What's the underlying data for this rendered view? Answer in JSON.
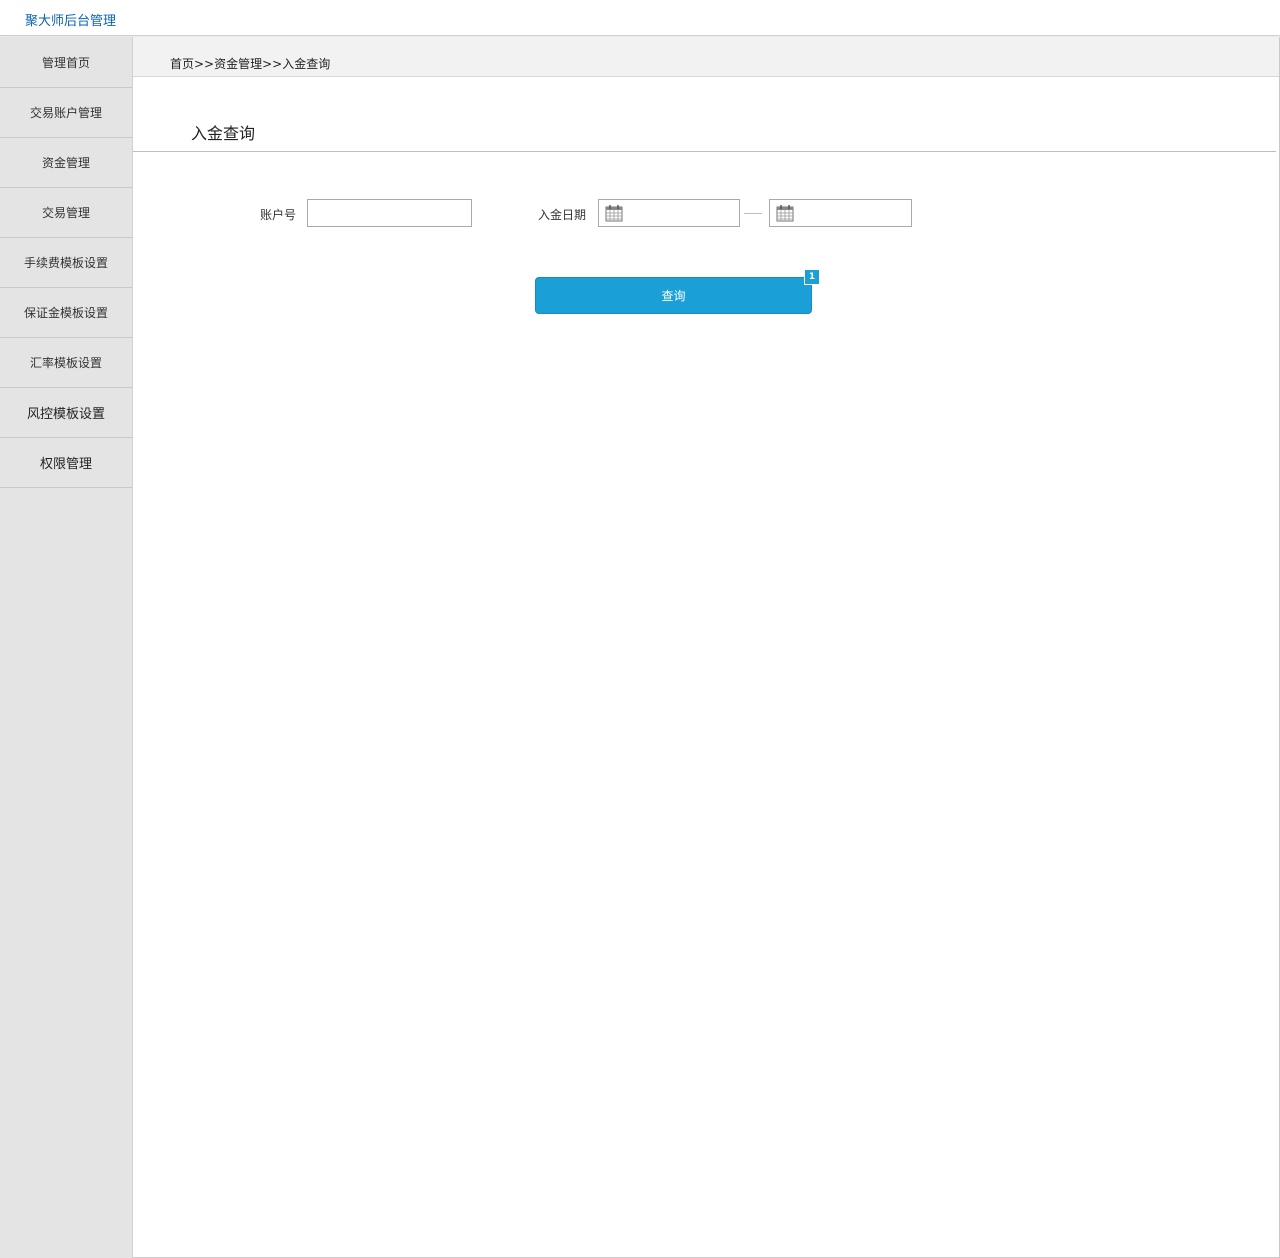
{
  "header": {
    "app_title": "聚大师后台管理"
  },
  "sidebar": {
    "items": [
      {
        "label": "管理首页"
      },
      {
        "label": "交易账户管理"
      },
      {
        "label": "资金管理"
      },
      {
        "label": "交易管理"
      },
      {
        "label": "手续费模板设置"
      },
      {
        "label": "保证金模板设置"
      },
      {
        "label": "汇率模板设置"
      },
      {
        "label": "风控模板设置"
      },
      {
        "label": "权限管理"
      }
    ]
  },
  "breadcrumb": "首页>>资金管理>>入金查询",
  "page": {
    "title": "入金查询",
    "form": {
      "account_label": "账户号",
      "account_value": "",
      "date_label": "入金日期",
      "date_from": "",
      "date_to": ""
    },
    "query_button": "查询",
    "annotation_marker": "1"
  },
  "icons": {
    "calendar": "calendar-icon"
  },
  "colors": {
    "brand": "#0a63b5",
    "button": "#1a9fd6",
    "sidebar_bg": "#e4e4e4"
  }
}
